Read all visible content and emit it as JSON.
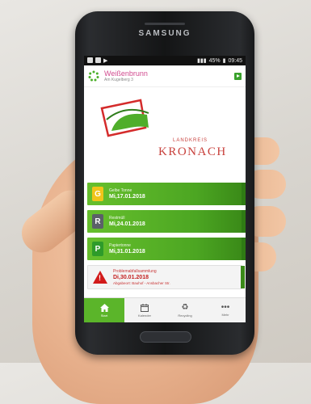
{
  "device": {
    "brand": "SAMSUNG"
  },
  "statusbar": {
    "time": "09:45",
    "battery": "45%"
  },
  "header": {
    "title": "Weißenbrunn",
    "subtitle": "Am Kugelberg 3"
  },
  "logo": {
    "small_text": "LANDKREIS",
    "big_text": "KRONACH"
  },
  "events": [
    {
      "type": "Gelbe Tonne",
      "date": "Mi,17.01.2018",
      "badge": "G",
      "badge_color": "#f0c419"
    },
    {
      "type": "Restmüll",
      "date": "Mi,24.01.2018",
      "badge": "R",
      "badge_color": "#5b6068"
    },
    {
      "type": "Papiertonne",
      "date": "Mi,31.01.2018",
      "badge": "P",
      "badge_color": "#2e9b2a"
    },
    {
      "type": "Problemabfallsammlung",
      "date": "Di,30.01.2018",
      "note": "Abgabeort: Bauhof - Ansbacher Str.",
      "badge": "!",
      "badge_color": "#d21a1a"
    }
  ],
  "tabs": [
    {
      "label": "Start",
      "icon": "home-icon"
    },
    {
      "label": "Kalender",
      "icon": "calendar-icon"
    },
    {
      "label": "Recycling",
      "icon": "recycle-icon"
    },
    {
      "label": "Mehr",
      "icon": "more-icon"
    }
  ]
}
